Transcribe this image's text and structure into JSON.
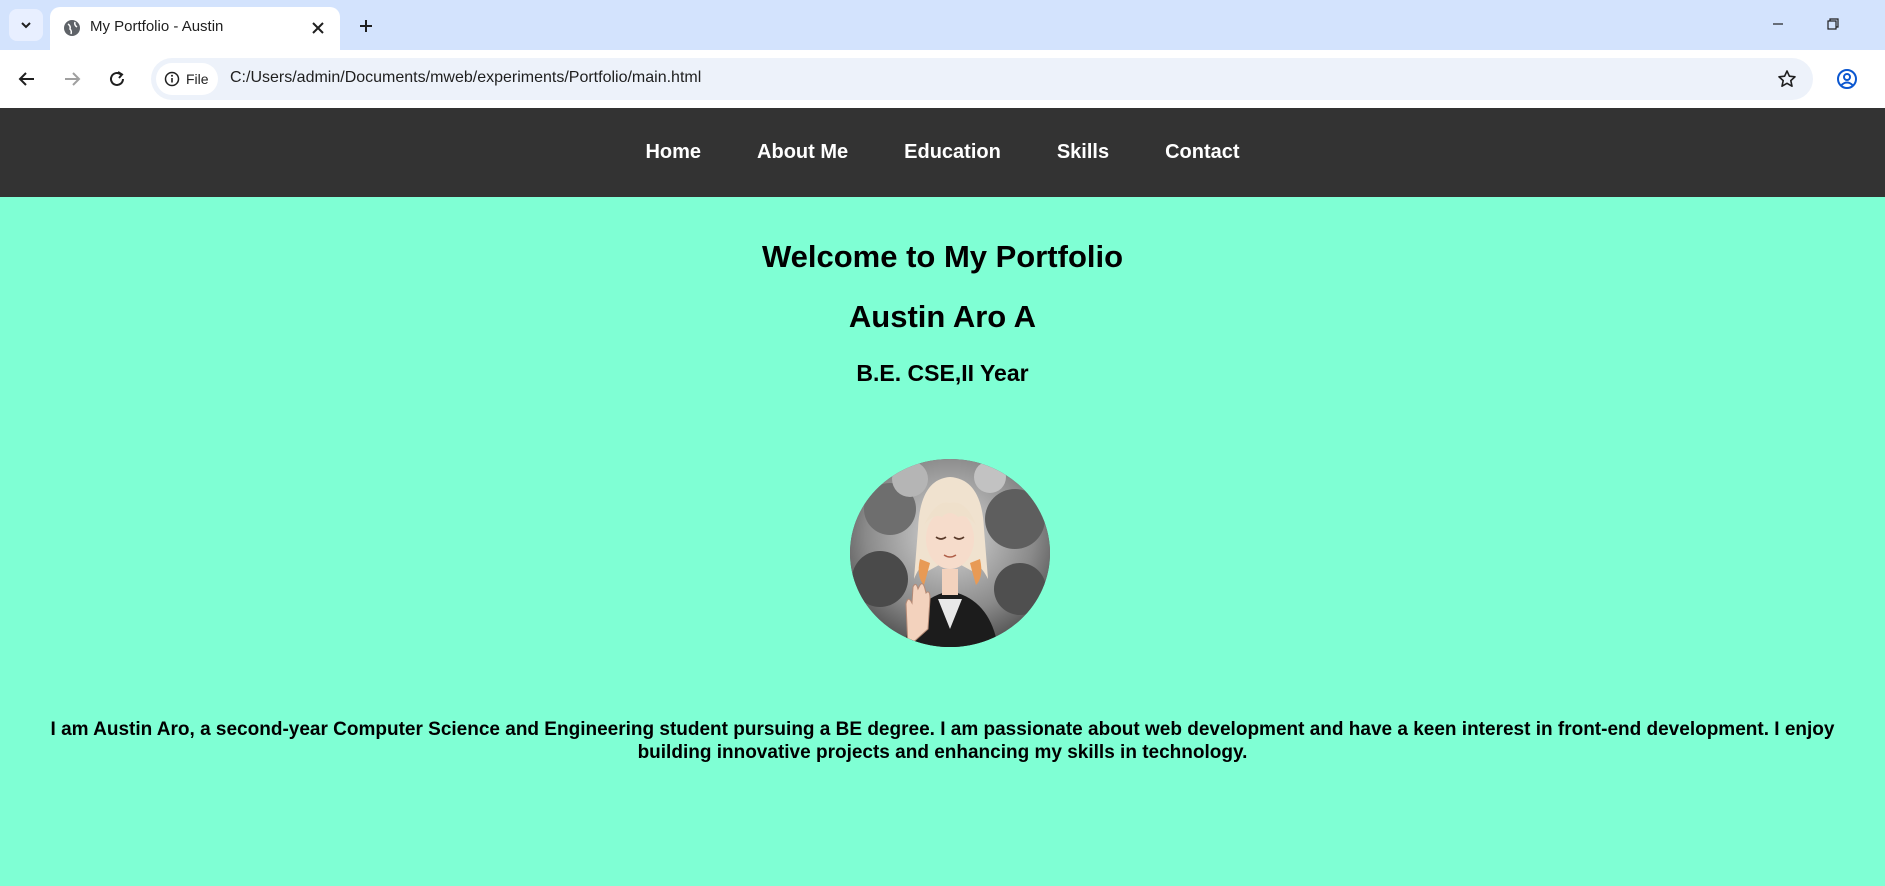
{
  "browser": {
    "tab_title": "My Portfolio - Austin",
    "site_chip_label": "File",
    "url": "C:/Users/admin/Documents/mweb/experiments/Portfolio/main.html"
  },
  "nav": {
    "items": [
      {
        "label": "Home"
      },
      {
        "label": "About Me"
      },
      {
        "label": "Education"
      },
      {
        "label": "Skills"
      },
      {
        "label": "Contact"
      }
    ]
  },
  "hero": {
    "welcome": "Welcome to My Portfolio",
    "name": "Austin Aro A",
    "degree": "B.E. CSE,II Year"
  },
  "about": {
    "text": "I am Austin Aro, a second-year Computer Science and Engineering student pursuing a BE degree. I am passionate about web development and have a keen interest in front-end development. I enjoy building innovative projects and enhancing my skills in technology."
  },
  "colors": {
    "page_background": "#7fffd4",
    "navbar_background": "#333333",
    "nav_text": "#ffffff",
    "tabstrip": "#d3e3fd"
  }
}
